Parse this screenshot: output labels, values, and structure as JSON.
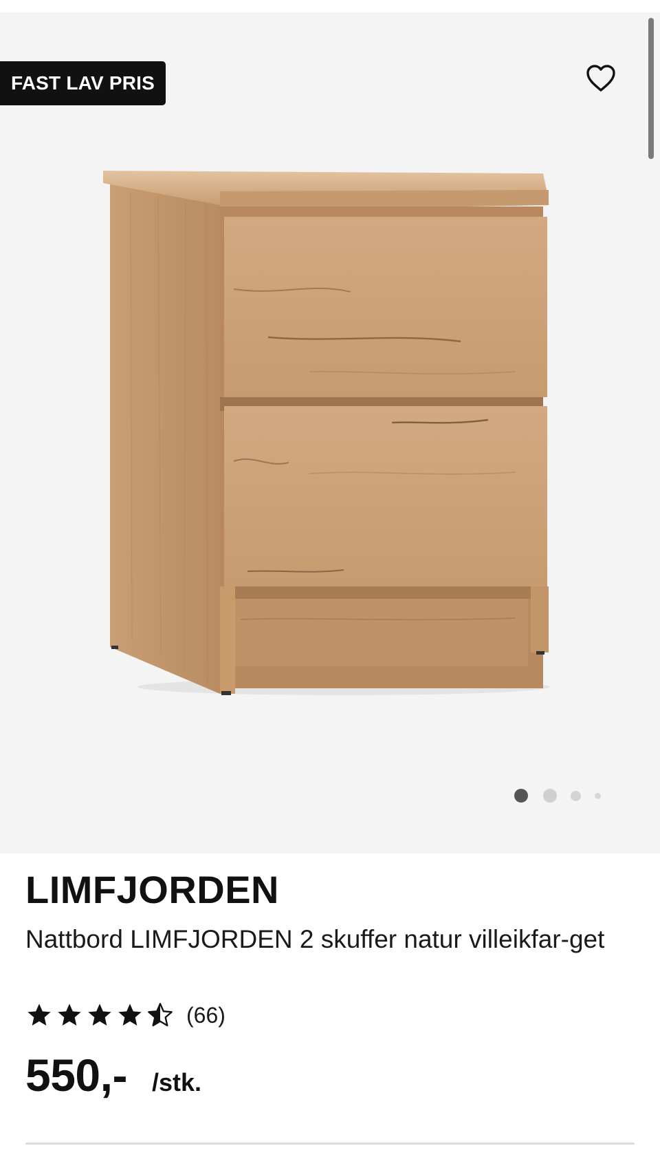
{
  "gallery": {
    "badge": "FAST LAV PRIS",
    "favorite_icon": "heart-outline-icon",
    "image_subject": "nightstand-with-2-drawers",
    "slides": {
      "count": 4,
      "active_index": 0
    }
  },
  "product": {
    "brand": "LIMFJORDEN",
    "description": "Nattbord LIMFJORDEN 2 skuffer natur villeikfar-get",
    "rating": {
      "value": 4.5,
      "max": 5,
      "count_label": "(66)"
    },
    "price": "550,-",
    "unit": "/stk."
  },
  "colors": {
    "text": "#111111",
    "badge_bg": "#111111",
    "badge_text": "#ffffff",
    "gallery_bg": "#f4f4f4",
    "dot_active": "#555555",
    "dot_inactive": "#cfcfcf",
    "wood": "#c9a079"
  }
}
